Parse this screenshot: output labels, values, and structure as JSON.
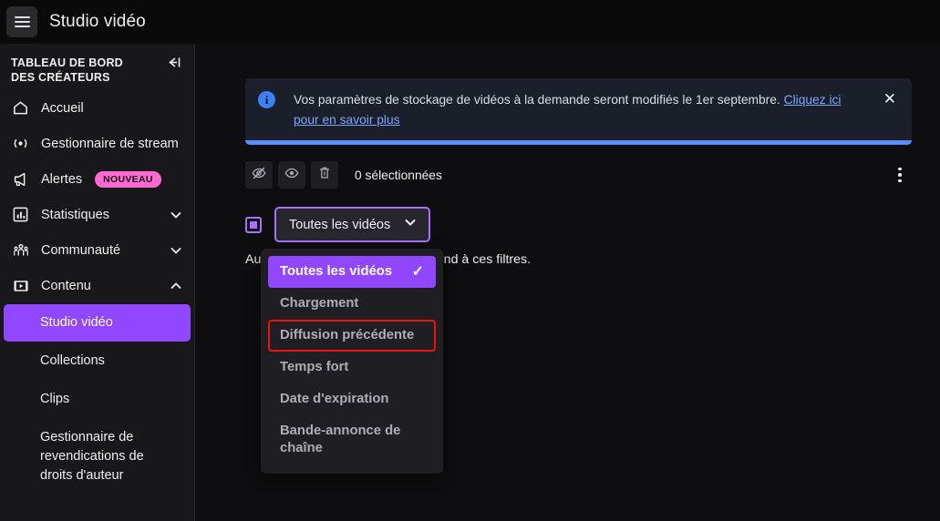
{
  "topbar": {
    "menu_icon": "hamburger-icon",
    "title": "Studio vidéo"
  },
  "sidebar": {
    "header_title": "TABLEAU DE BORD DES CRÉATEURS",
    "collapse_icon": "collapse-left-icon",
    "items": [
      {
        "label": "Accueil",
        "icon": "home-icon",
        "chevron": "",
        "badge": ""
      },
      {
        "label": "Gestionnaire de stream",
        "icon": "broadcast-icon",
        "chevron": "",
        "badge": ""
      },
      {
        "label": "Alertes",
        "icon": "megaphone-icon",
        "chevron": "",
        "badge": "NOUVEAU"
      },
      {
        "label": "Statistiques",
        "icon": "bar-chart-icon",
        "chevron": "chevron-down-icon",
        "badge": ""
      },
      {
        "label": "Communauté",
        "icon": "community-icon",
        "chevron": "chevron-down-icon",
        "badge": ""
      },
      {
        "label": "Contenu",
        "icon": "content-video-icon",
        "chevron": "chevron-up-icon",
        "badge": ""
      }
    ],
    "sub_items": [
      {
        "label": "Studio vidéo",
        "active": true
      },
      {
        "label": "Collections",
        "active": false
      },
      {
        "label": "Clips",
        "active": false
      },
      {
        "label": "Gestionnaire de revendications de droits d'auteur",
        "active": false
      }
    ]
  },
  "banner": {
    "icon": "info-icon",
    "text": "Vos paramètres de stockage de vidéos à la demande seront modifiés le 1er septembre. ",
    "link_text": "Cliquez ici pour en savoir plus",
    "close_icon": "close-icon",
    "accent_color": "#5b8dff"
  },
  "toolbar": {
    "buttons": [
      {
        "name": "hide-video-button",
        "icon": "eye-off-icon"
      },
      {
        "name": "show-video-button",
        "icon": "eye-icon"
      },
      {
        "name": "delete-video-button",
        "icon": "trash-icon"
      }
    ],
    "selection_count": "0 sélectionnées",
    "more_icon": "kebab-menu-icon"
  },
  "filter": {
    "checkbox_icon": "partial-checkbox-icon",
    "button_label": "Toutes les vidéos",
    "chevron_icon": "chevron-down-icon",
    "accent_color": "#a970ff"
  },
  "empty_state": {
    "text": "Aucune de vos vidéos ne correspond à ces filtres."
  },
  "dropdown": {
    "options": [
      {
        "label": "Toutes les vidéos",
        "selected": true,
        "highlighted": false,
        "check_icon": "check-icon"
      },
      {
        "label": "Chargement",
        "selected": false,
        "highlighted": false,
        "check_icon": ""
      },
      {
        "label": "Diffusion précédente",
        "selected": false,
        "highlighted": true,
        "check_icon": ""
      },
      {
        "label": "Temps fort",
        "selected": false,
        "highlighted": false,
        "check_icon": ""
      },
      {
        "label": "Date d'expiration",
        "selected": false,
        "highlighted": false,
        "check_icon": ""
      },
      {
        "label": "Bande-annonce de chaîne",
        "selected": false,
        "highlighted": false,
        "check_icon": ""
      }
    ],
    "highlight_color": "#ee1111",
    "selected_color": "#9147ff"
  }
}
